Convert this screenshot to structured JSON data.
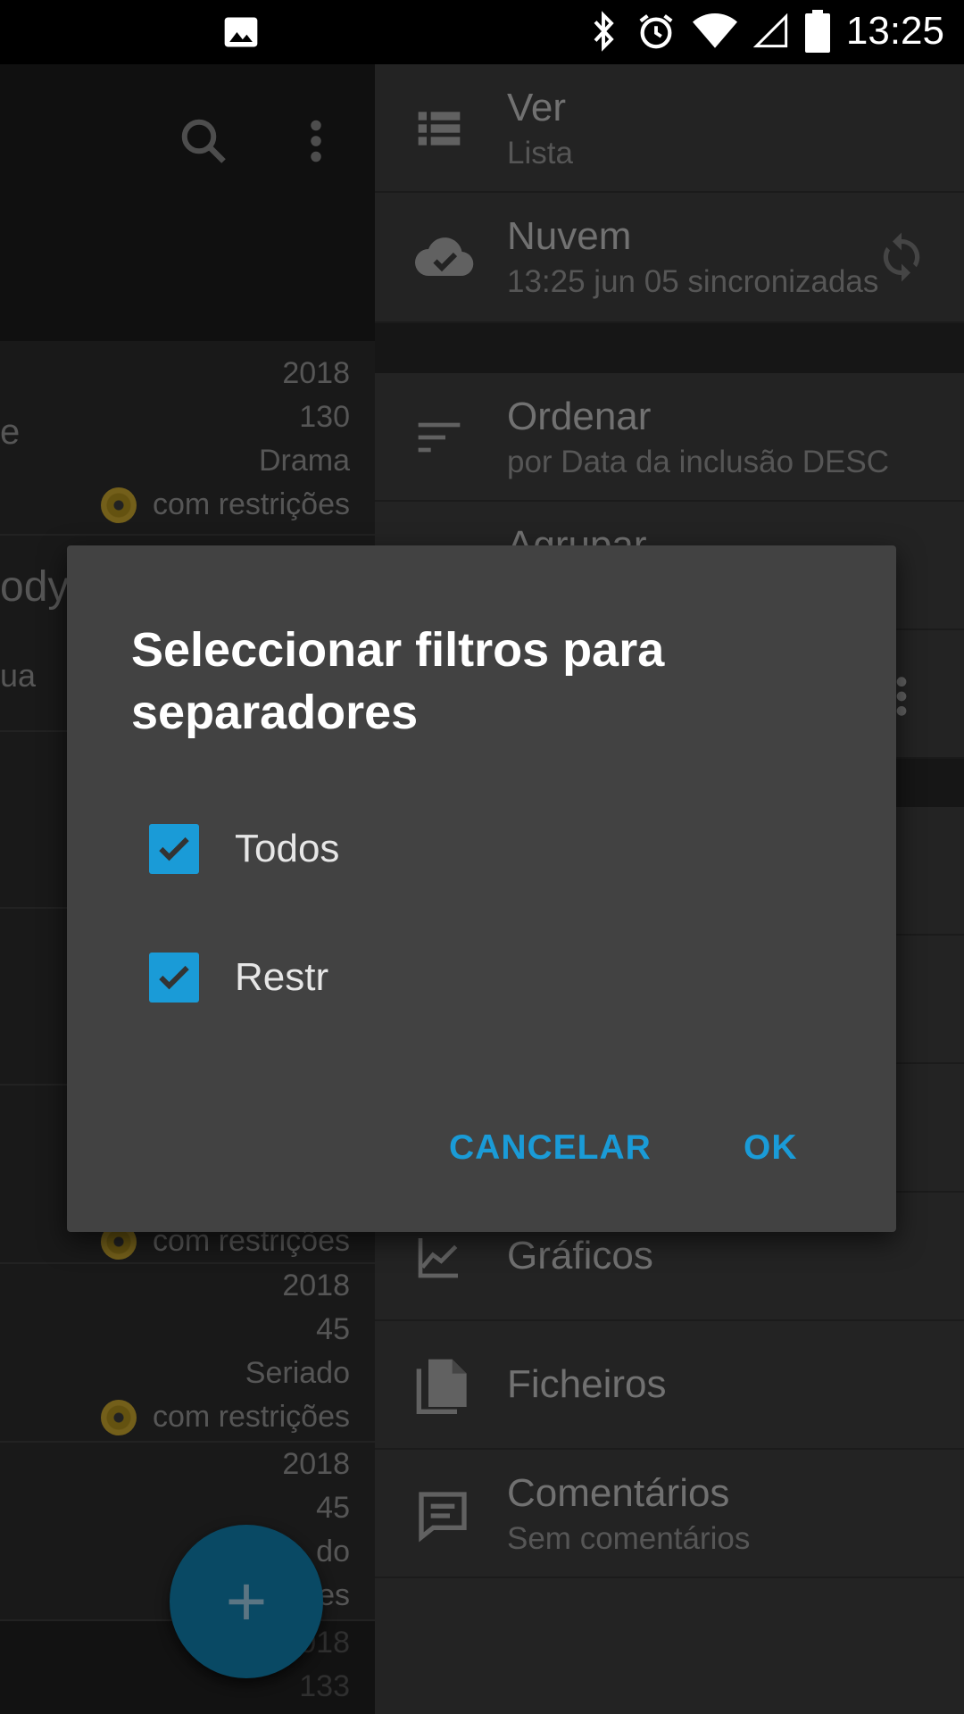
{
  "status_bar": {
    "time": "13:25",
    "icons": [
      "image-icon",
      "bluetooth-icon",
      "alarm-icon",
      "wifi-icon",
      "signal-icon",
      "battery-icon"
    ]
  },
  "left_list": {
    "toolbar_icons": [
      "search-icon",
      "more-vert-icon"
    ],
    "rows": [
      {
        "fragment": "e",
        "year": "2018",
        "count": "130",
        "genre": "Drama",
        "restriction": "com restrições"
      },
      {
        "fragment": "ody"
      },
      {
        "fragment": "ua"
      },
      {
        "restriction": "com restrições"
      },
      {
        "year": "2018",
        "count": "45",
        "genre": "Seriado",
        "restriction": "com restrições"
      },
      {
        "year": "2018",
        "count": "45",
        "genre": "do",
        "restriction": "es"
      },
      {
        "year": "018",
        "count": "133"
      }
    ]
  },
  "drawer": {
    "items": [
      {
        "icon": "view-list-icon",
        "title": "Ver",
        "subtitle": "Lista"
      },
      {
        "icon": "cloud-done-icon",
        "title": "Nuvem",
        "subtitle": "13:25 jun 05 sincronizadas",
        "action_icon": "sync-icon"
      },
      {
        "icon": "sort-icon",
        "title": "Ordenar",
        "subtitle": "por Data da inclusão DESC"
      },
      {
        "icon": "group-icon",
        "title": "Agrupar"
      },
      {
        "icon": "chart-icon",
        "title": "Gráficos"
      },
      {
        "icon": "files-icon",
        "title": "Ficheiros"
      },
      {
        "icon": "comment-icon",
        "title": "Comentários",
        "subtitle": "Sem comentários"
      }
    ]
  },
  "fab": {
    "label": "+"
  },
  "dialog": {
    "title": "Seleccionar filtros para separadores",
    "options": [
      {
        "label": "Todos",
        "checked": true
      },
      {
        "label": "Restr",
        "checked": true
      }
    ],
    "cancel_label": "CANCELAR",
    "ok_label": "OK"
  },
  "colors": {
    "accent": "#1a9bd7",
    "dialog_bg": "#424242",
    "drawer_bg": "#2b2b2b"
  }
}
